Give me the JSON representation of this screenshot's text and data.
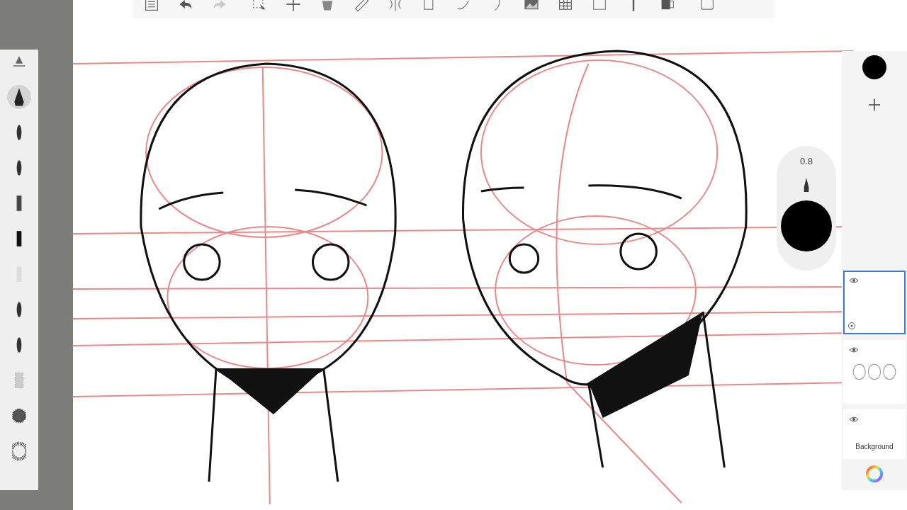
{
  "brush_panel": {
    "brushes": [
      {
        "kind": "pen",
        "selected": true
      },
      {
        "kind": "soft",
        "selected": false
      },
      {
        "kind": "soft",
        "selected": false
      },
      {
        "kind": "chalk",
        "selected": false
      },
      {
        "kind": "marker",
        "selected": false
      },
      {
        "kind": "faint",
        "selected": false
      },
      {
        "kind": "soft",
        "selected": false
      },
      {
        "kind": "soft",
        "selected": false
      },
      {
        "kind": "pencil",
        "selected": false
      },
      {
        "kind": "splatter",
        "selected": false
      },
      {
        "kind": "dots",
        "selected": false
      }
    ]
  },
  "brush_size": {
    "reading": "0.8"
  },
  "layers": [
    {
      "kind": "blank",
      "selected": true,
      "visible": true
    },
    {
      "kind": "thumbnail",
      "selected": false,
      "visible": true
    },
    {
      "kind": "background",
      "selected": false,
      "visible": true,
      "label": "Background"
    }
  ]
}
